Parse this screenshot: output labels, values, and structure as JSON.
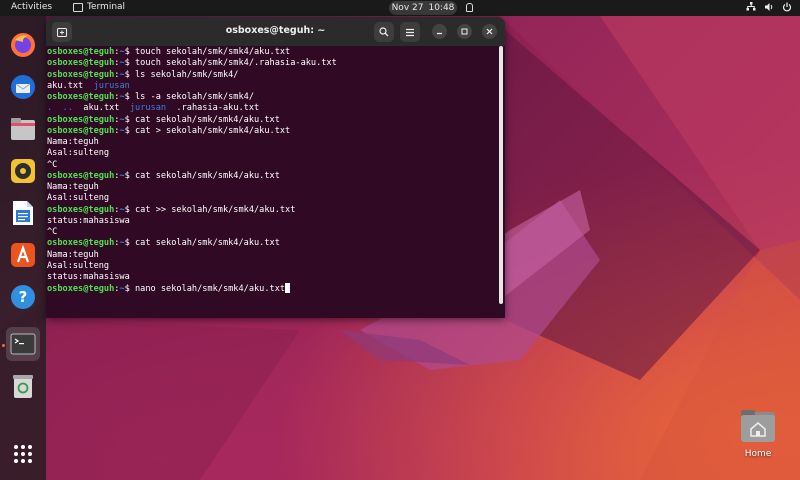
{
  "topbar": {
    "activities": "Activities",
    "app_name": "Terminal",
    "clock_date": "Nov 27",
    "clock_time": "10:48"
  },
  "dock": {
    "items": [
      {
        "name": "firefox-icon"
      },
      {
        "name": "thunderbird-icon"
      },
      {
        "name": "files-icon"
      },
      {
        "name": "rhythmbox-icon"
      },
      {
        "name": "libreoffice-writer-icon"
      },
      {
        "name": "app-center-icon"
      },
      {
        "name": "help-icon"
      },
      {
        "name": "terminal-icon"
      },
      {
        "name": "trash-icon"
      },
      {
        "name": "show-apps-icon"
      }
    ]
  },
  "window": {
    "title": "osboxes@teguh: ~"
  },
  "terminal": {
    "prompt_user": "osboxes@teguh",
    "prompt_colon": ":",
    "prompt_path": "~",
    "prompt_dollar": "$ ",
    "lines": [
      {
        "type": "cmd",
        "text": "touch sekolah/smk/smk4/aku.txt"
      },
      {
        "type": "cmd",
        "text": "touch sekolah/smk/smk4/.rahasia-aku.txt"
      },
      {
        "type": "cmd",
        "text": "ls sekolah/smk/smk4/"
      },
      {
        "type": "ls",
        "file": "aku.txt",
        "dir": "jurusan"
      },
      {
        "type": "cmd",
        "text": "ls -a sekolah/smk/smk4/"
      },
      {
        "type": "lsa",
        "dot": ".",
        "dotdot": "..",
        "file": "aku.txt",
        "dir": "jurusan",
        "hidden": ".rahasia-aku.txt"
      },
      {
        "type": "cmd",
        "text": "cat sekolah/smk/smk4/aku.txt"
      },
      {
        "type": "cmd",
        "text": "cat > sekolah/smk/smk4/aku.txt"
      },
      {
        "type": "out",
        "text": "Nama:teguh"
      },
      {
        "type": "out",
        "text": "Asal:sulteng"
      },
      {
        "type": "out",
        "text": "^C"
      },
      {
        "type": "cmd",
        "text": "cat sekolah/smk/smk4/aku.txt"
      },
      {
        "type": "out",
        "text": "Nama:teguh"
      },
      {
        "type": "out",
        "text": "Asal:sulteng"
      },
      {
        "type": "cmd",
        "text": "cat >> sekolah/smk/smk4/aku.txt"
      },
      {
        "type": "out",
        "text": "status:mahasiswa"
      },
      {
        "type": "out",
        "text": "^C"
      },
      {
        "type": "cmd",
        "text": "cat sekolah/smk/smk4/aku.txt"
      },
      {
        "type": "out",
        "text": "Nama:teguh"
      },
      {
        "type": "out",
        "text": "Asal:sulteng"
      },
      {
        "type": "out",
        "text": "status:mahasiswa"
      },
      {
        "type": "cmd",
        "text": "nano sekolah/smk/smk4/aku.txt",
        "cursor": true
      }
    ]
  },
  "desktop": {
    "home_label": "Home"
  },
  "colors": {
    "terminal_bg": "#300a24",
    "prompt_user": "#4ee04e",
    "prompt_path": "#3a7ee0"
  }
}
